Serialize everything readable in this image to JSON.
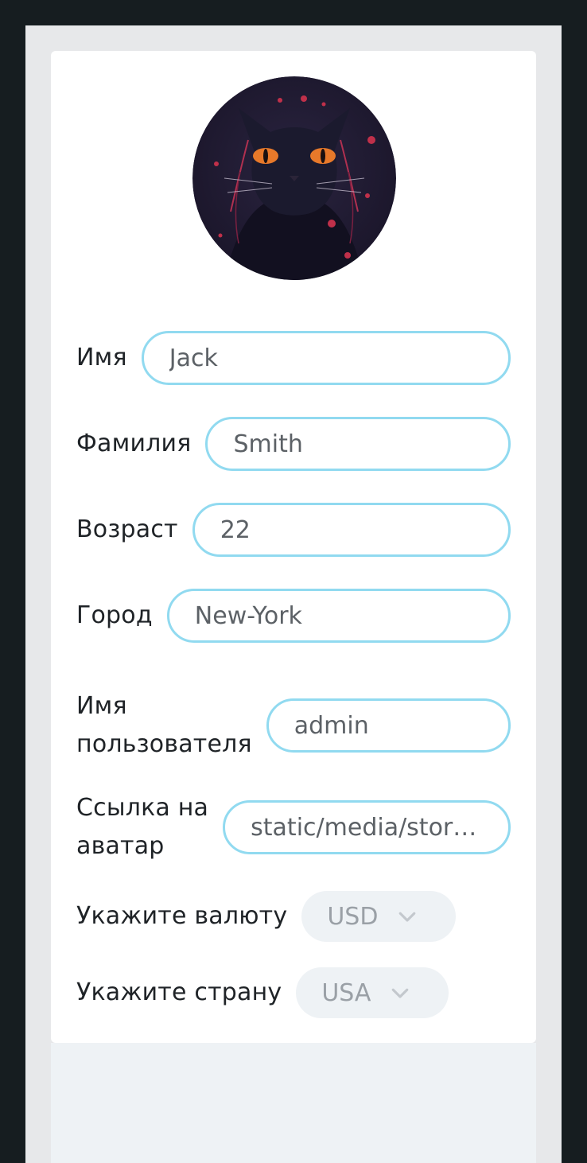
{
  "profile": {
    "avatar_alt": "avatar",
    "fields": {
      "first_name": {
        "label": "Имя",
        "value": "Jack"
      },
      "last_name": {
        "label": "Фамилия",
        "value": "Smith"
      },
      "age": {
        "label": "Возраст",
        "value": "22"
      },
      "city": {
        "label": "Город",
        "value": "New-York"
      },
      "username": {
        "label_line1": "Имя",
        "label_line2": "пользователя",
        "value": "admin"
      },
      "avatar_link": {
        "label_line1": "Ссылка на",
        "label_line2": "аватар",
        "value": "static/media/storyb..."
      }
    },
    "currency": {
      "label": "Укажите валюту",
      "selected": "USD",
      "icon": "chevron-down-icon"
    },
    "country": {
      "label": "Укажите страну",
      "selected": "USA",
      "icon": "chevron-down-icon"
    }
  },
  "colors": {
    "page_bg": "#161d20",
    "frame_bg": "#e7e8ea",
    "card_bg": "#ffffff",
    "input_border": "#91daf0",
    "select_bg": "#eef2f5",
    "label_text": "#1f2327",
    "value_text": "#5c6166",
    "placeholder_text": "#9aa0a6"
  }
}
